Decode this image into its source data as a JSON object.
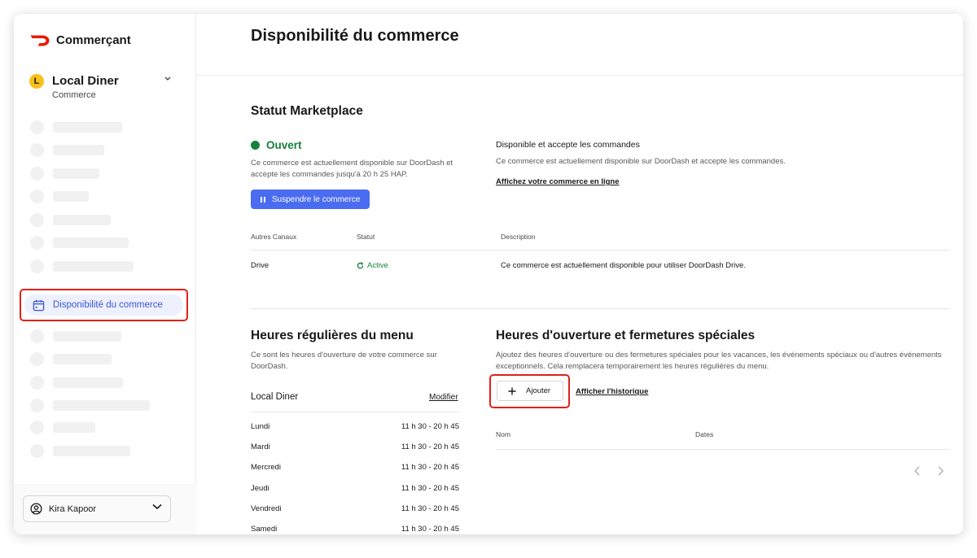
{
  "brand": {
    "name": "Commerçant",
    "accent": "#eb1700"
  },
  "store": {
    "initial": "L",
    "name": "Local Diner",
    "type": "Commerce"
  },
  "sidebar": {
    "active_item": {
      "label": "Disponibilité du commerce",
      "icon": "calendar-icon"
    },
    "user": {
      "name": "Kira Kapoor",
      "icon": "user-circle-icon"
    }
  },
  "page": {
    "title": "Disponibilité du commerce"
  },
  "marketplace": {
    "title": "Statut Marketplace",
    "status": "Ouvert",
    "status_desc": "Ce commerce est actuellement disponible sur DoorDash et accepte les commandes jusqu'à 20 h 25 HAP.",
    "suspend_button": "Suspendre le commerce",
    "right_title": "Disponible et accepte les commandes",
    "right_desc": "Ce commerce est actuellement disponible sur DoorDash et accepte les commandes.",
    "view_online_link": "Affichez votre commerce en ligne"
  },
  "channels": {
    "headers": {
      "channel": "Autres Canaux",
      "status": "Statut",
      "description": "Description"
    },
    "rows": [
      {
        "channel": "Drive",
        "status": "Active",
        "description": "Ce commerce est actuellement disponible pour utiliser DoorDash Drive."
      }
    ]
  },
  "regular_hours": {
    "title": "Heures régulières du menu",
    "desc": "Ce sont les heures d'ouverture de votre commerce sur DoorDash.",
    "menu_name": "Local Diner",
    "edit_link": "Modifier",
    "days": [
      {
        "day": "Lundi",
        "hours": "11 h 30 - 20 h 45"
      },
      {
        "day": "Mardi",
        "hours": "11 h 30 - 20 h 45"
      },
      {
        "day": "Mercredi",
        "hours": "11 h 30 - 20 h 45"
      },
      {
        "day": "Jeudi",
        "hours": "11 h 30 - 20 h 45"
      },
      {
        "day": "Vendredi",
        "hours": "11 h 30 - 20 h 45"
      },
      {
        "day": "Samedi",
        "hours": "11 h 30 - 20 h 45"
      }
    ]
  },
  "special_hours": {
    "title": "Heures d'ouverture et fermetures spéciales",
    "desc": "Ajoutez des heures d'ouverture ou des fermetures spéciales pour les vacances, les événements spéciaux ou d'autres événements exceptionnels. Cela remplacera temporairement les heures régulières du menu.",
    "add_button": "Ajouter",
    "history_link": "Afficher l'historique",
    "table_headers": {
      "name": "Nom",
      "dates": "Dates"
    }
  },
  "colors": {
    "primary_button": "#4a6cf0",
    "open_green": "#16813c",
    "highlight_red": "#e0211a"
  }
}
